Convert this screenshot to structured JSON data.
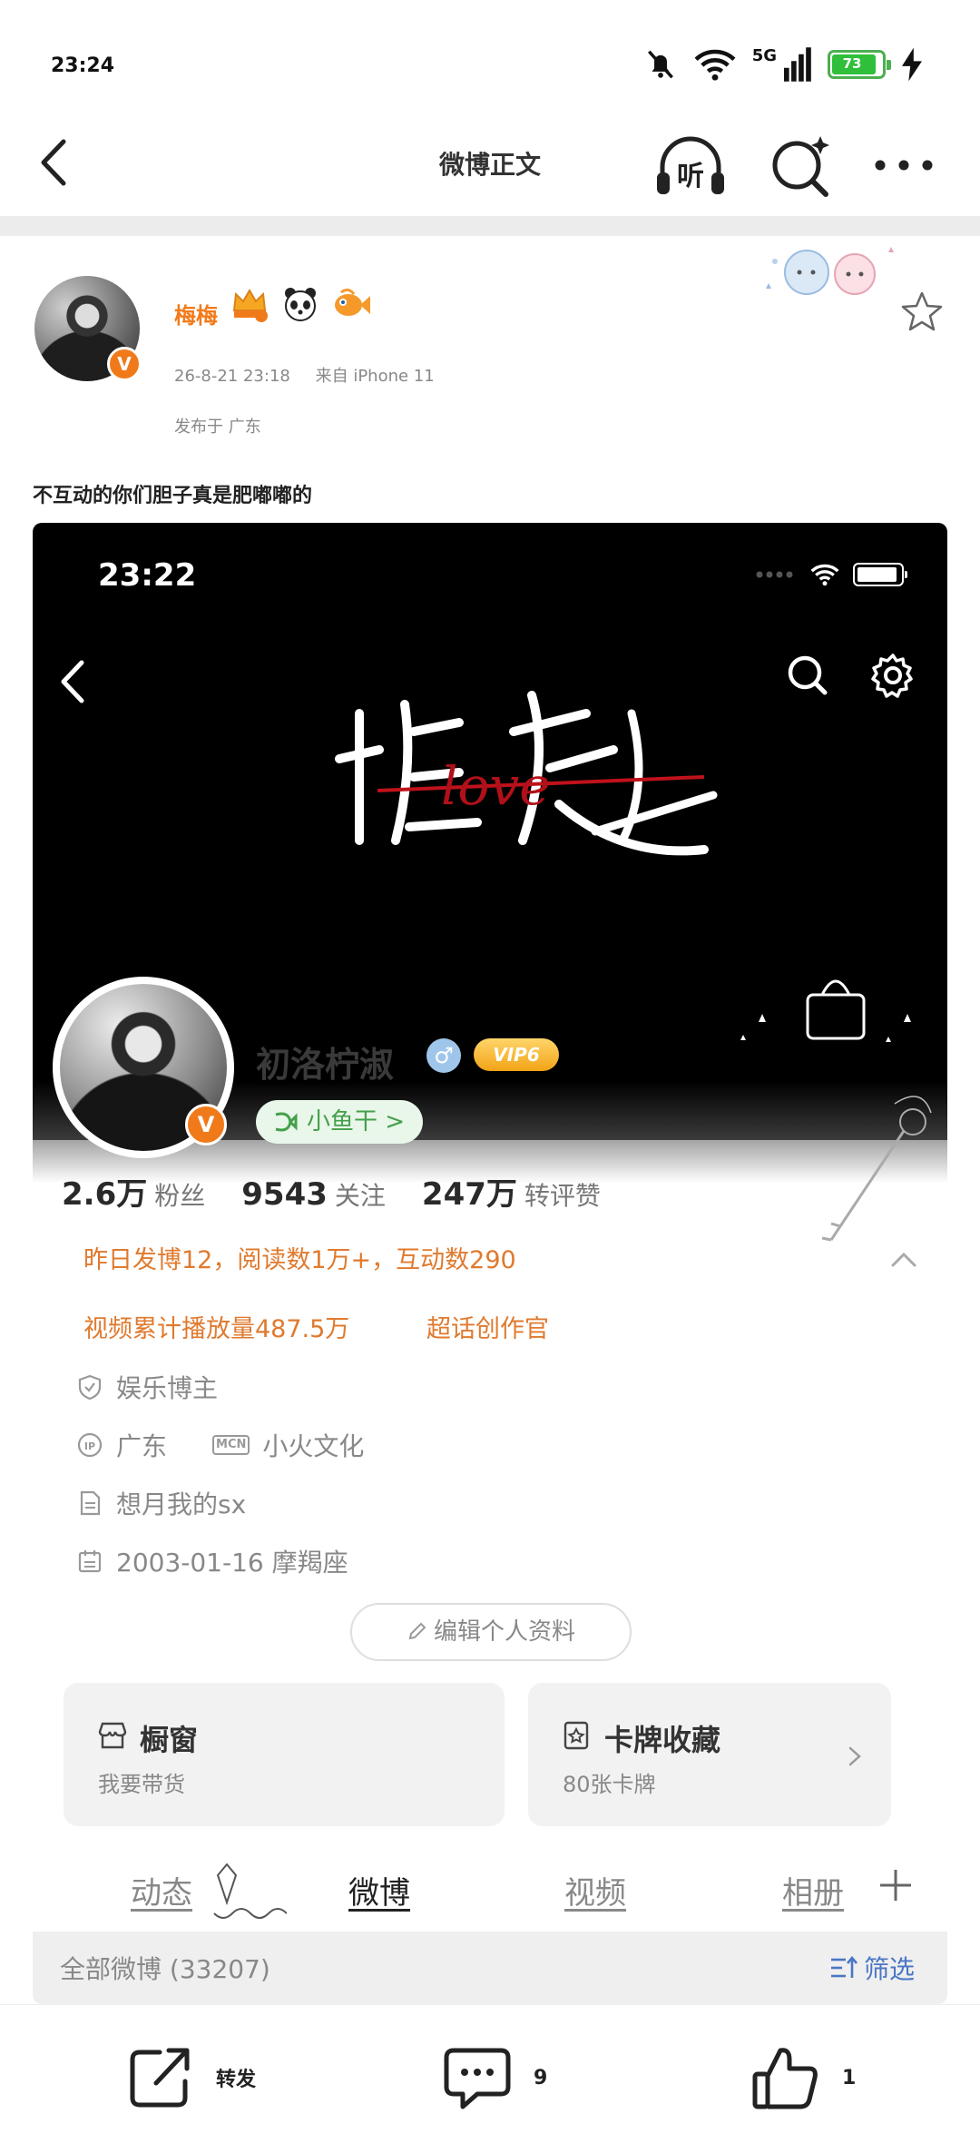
{
  "status_bar": {
    "time": "23:24",
    "network": "5G",
    "battery": "73"
  },
  "nav": {
    "title": "微博正文",
    "listen_label": "听"
  },
  "post": {
    "author": "梅梅",
    "timestamp": "26-8-21 23:18",
    "source": "来自 iPhone 11",
    "location": "发布于 广东",
    "text": "不互动的你们胆子真是肥嘟嘟的",
    "verified_badge": "V"
  },
  "embedded": {
    "time": "23:22",
    "calligraphy_text": "love",
    "name": "初洛柠淑",
    "gender_symbol": "♂",
    "vip_label": "VIP6",
    "fish_label": "小鱼干 >",
    "stats": [
      {
        "num": "2.6万",
        "label": "粉丝"
      },
      {
        "num": "9543",
        "label": "关注"
      },
      {
        "num": "247万",
        "label": "转评赞"
      }
    ],
    "activity": "昨日发博12，阅读数1万+，互动数290",
    "video_stat": "视频累计播放量487.5万",
    "supertopic": "超话创作官",
    "category": "娱乐博主",
    "ip_location": "广东",
    "mcn_tag": "MCN",
    "mcn_name": "小火文化",
    "bio": "想月我的sx",
    "birthday": "2003-01-16 摩羯座",
    "edit_button": "编辑个人资料",
    "cards": [
      {
        "title": "橱窗",
        "sub": "我要带货",
        "icon": "shop-icon"
      },
      {
        "title": "卡牌收藏",
        "sub": "80张卡牌",
        "icon": "card-icon"
      }
    ],
    "tabs": [
      "动态",
      "微博",
      "视频",
      "相册"
    ],
    "active_tab": "微博",
    "filter_all": "全部微博 (33207)",
    "filter_label": "筛选"
  },
  "bottom": {
    "repost": "转发",
    "comments": "9",
    "likes": "1"
  },
  "colors": {
    "accent": "#f27a1a",
    "activity": "#e07a2e",
    "link_blue": "#4a76c4",
    "fish_green": "#43a04a"
  }
}
